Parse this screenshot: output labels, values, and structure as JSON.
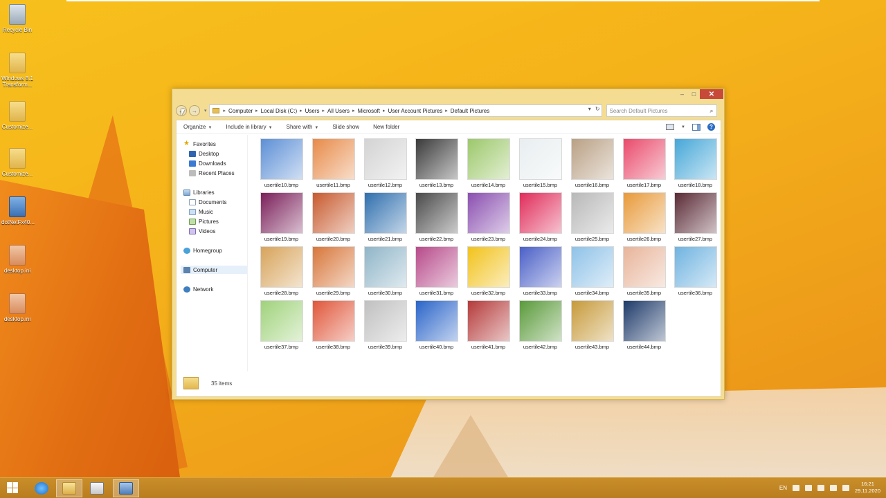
{
  "desktop": {
    "icons": [
      {
        "label": "Recycle Bin",
        "icon": "recycle-bin-icon"
      },
      {
        "label": "Windows 8.1 Transform...",
        "icon": "folder-icon"
      },
      {
        "label": "Customize...",
        "icon": "folder-icon"
      },
      {
        "label": "Customize...",
        "icon": "folder-icon"
      },
      {
        "label": "dotNetFx40...",
        "icon": "installer-icon"
      },
      {
        "label": "desktop.ini",
        "icon": "ini-file-icon"
      },
      {
        "label": "desktop.ini",
        "icon": "ini-file-icon"
      }
    ]
  },
  "window": {
    "controls": {
      "minimize": "–",
      "maximize": "□",
      "close": "✕"
    },
    "nav": {
      "back": "←",
      "forward": "→"
    },
    "address": {
      "crumbs": [
        "Computer",
        "Local Disk (C:)",
        "Users",
        "All Users",
        "Microsoft",
        "User Account Pictures",
        "Default Pictures"
      ]
    },
    "search": {
      "placeholder": "Search Default Pictures"
    },
    "toolbar": {
      "organize": "Organize",
      "include_in_library": "Include in library",
      "share_with": "Share with",
      "slide_show": "Slide show",
      "new_folder": "New folder"
    },
    "navpane": {
      "favorites": "Favorites",
      "desktop": "Desktop",
      "downloads": "Downloads",
      "recent_places": "Recent Places",
      "libraries": "Libraries",
      "documents": "Documents",
      "music": "Music",
      "pictures": "Pictures",
      "videos": "Videos",
      "homegroup": "Homegroup",
      "computer": "Computer",
      "network": "Network"
    },
    "files": [
      {
        "name": "usertile10.bmp",
        "color": "#5c8fd6"
      },
      {
        "name": "usertile11.bmp",
        "color": "#e88a48"
      },
      {
        "name": "usertile12.bmp",
        "color": "#d3d3d3"
      },
      {
        "name": "usertile13.bmp",
        "color": "#3a3a3a"
      },
      {
        "name": "usertile14.bmp",
        "color": "#9cc86a"
      },
      {
        "name": "usertile15.bmp",
        "color": "#e8eef0"
      },
      {
        "name": "usertile16.bmp",
        "color": "#b9a084"
      },
      {
        "name": "usertile17.bmp",
        "color": "#e94a6b"
      },
      {
        "name": "usertile18.bmp",
        "color": "#45a7d8"
      },
      {
        "name": "usertile19.bmp",
        "color": "#7a1f5a"
      },
      {
        "name": "usertile20.bmp",
        "color": "#c85a2e"
      },
      {
        "name": "usertile21.bmp",
        "color": "#2f6fae"
      },
      {
        "name": "usertile22.bmp",
        "color": "#4a4a4a"
      },
      {
        "name": "usertile23.bmp",
        "color": "#8a4fb0"
      },
      {
        "name": "usertile24.bmp",
        "color": "#e02c5a"
      },
      {
        "name": "usertile25.bmp",
        "color": "#b8b8b8"
      },
      {
        "name": "usertile26.bmp",
        "color": "#e89a3a"
      },
      {
        "name": "usertile27.bmp",
        "color": "#5a2a36"
      },
      {
        "name": "usertile28.bmp",
        "color": "#d7a35a"
      },
      {
        "name": "usertile29.bmp",
        "color": "#d8763a"
      },
      {
        "name": "usertile30.bmp",
        "color": "#8fb5c8"
      },
      {
        "name": "usertile31.bmp",
        "color": "#b74a8a"
      },
      {
        "name": "usertile32.bmp",
        "color": "#f2c21a"
      },
      {
        "name": "usertile33.bmp",
        "color": "#4a5fc7"
      },
      {
        "name": "usertile34.bmp",
        "color": "#8ec2e8"
      },
      {
        "name": "usertile35.bmp",
        "color": "#e8b49a"
      },
      {
        "name": "usertile36.bmp",
        "color": "#6fb3e0"
      },
      {
        "name": "usertile37.bmp",
        "color": "#9fd27a"
      },
      {
        "name": "usertile38.bmp",
        "color": "#e0563a"
      },
      {
        "name": "usertile39.bmp",
        "color": "#c0c0c0"
      },
      {
        "name": "usertile40.bmp",
        "color": "#2a64c9"
      },
      {
        "name": "usertile41.bmp",
        "color": "#b53a3a"
      },
      {
        "name": "usertile42.bmp",
        "color": "#5a9a3a"
      },
      {
        "name": "usertile43.bmp",
        "color": "#c79a3a"
      },
      {
        "name": "usertile44.bmp",
        "color": "#1e3a6a"
      }
    ],
    "status": {
      "items_count": "35 items"
    }
  },
  "taskbar": {
    "apps": [
      {
        "name": "start",
        "icon": "windows-logo-icon"
      },
      {
        "name": "internet-explorer",
        "icon": "ie-icon"
      },
      {
        "name": "file-explorer",
        "icon": "folder-icon"
      },
      {
        "name": "media-player",
        "icon": "media-icon"
      },
      {
        "name": "remote-desktop",
        "icon": "remote-icon"
      }
    ],
    "tray": {
      "language": "EN",
      "time": "16:21",
      "date": "29.11.2020"
    }
  }
}
